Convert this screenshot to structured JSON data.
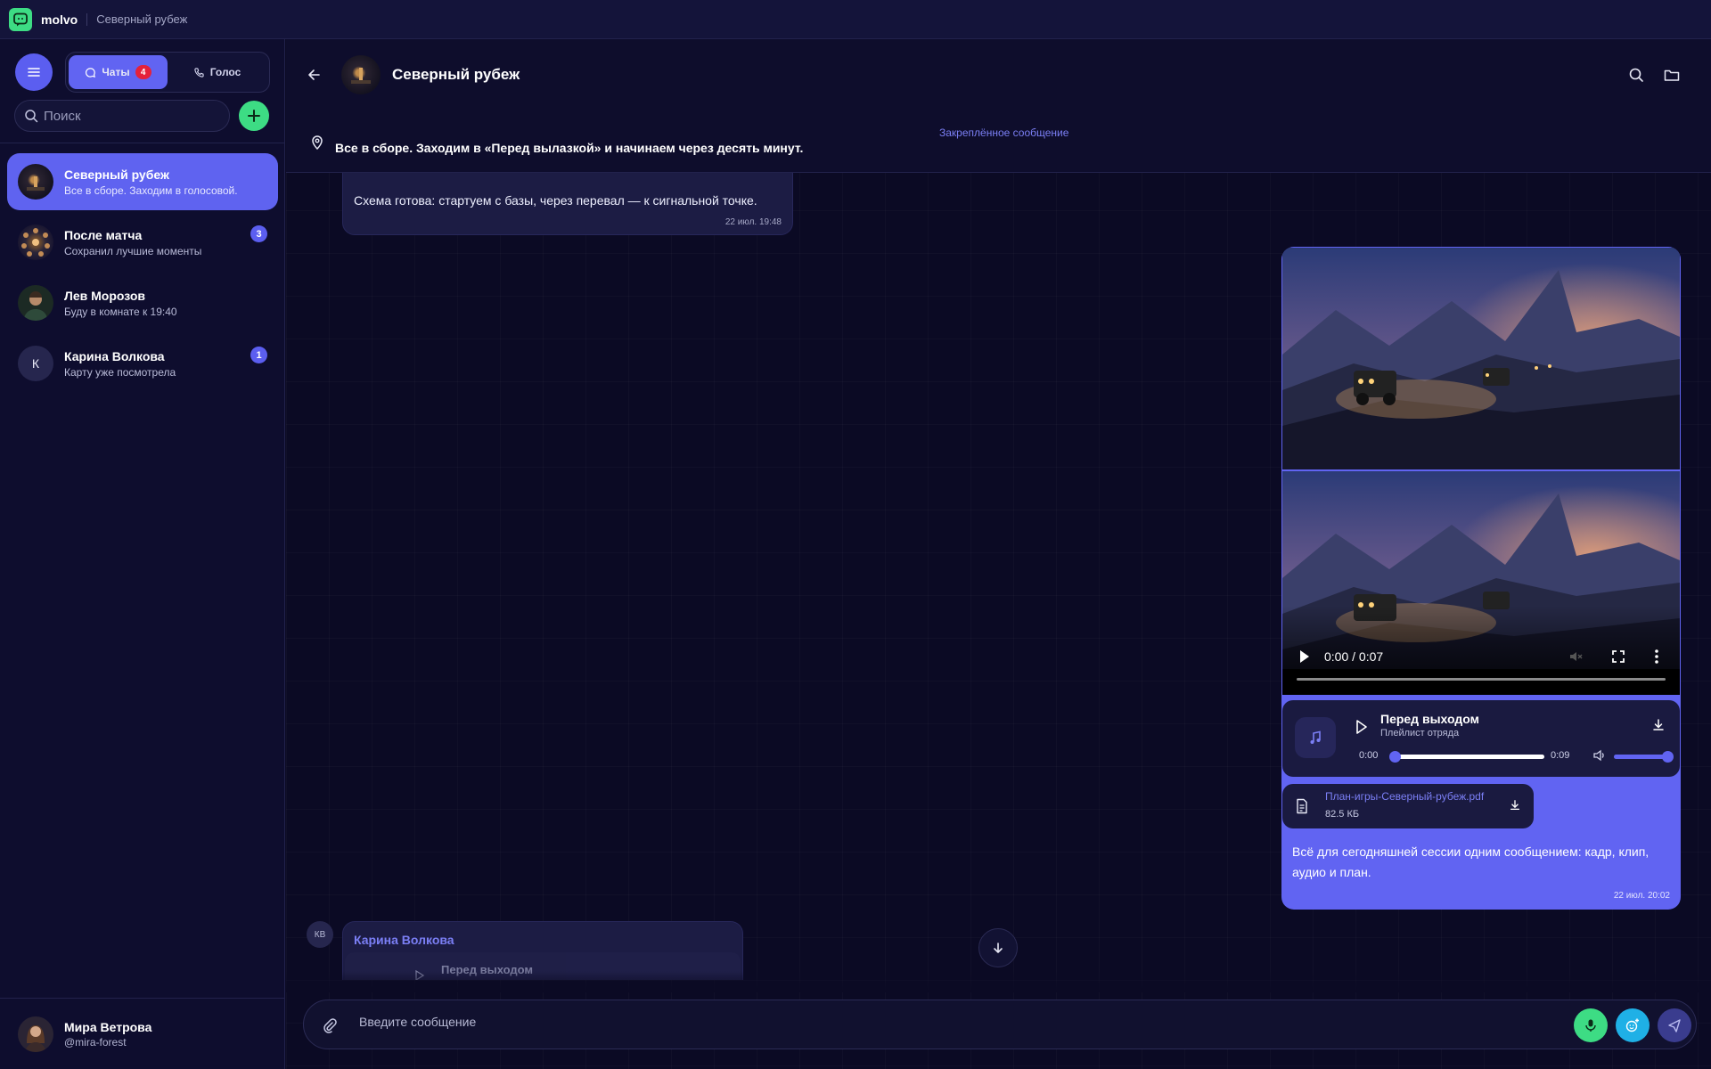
{
  "app": {
    "logo_text": "molvo",
    "window_title": "Северный рубеж"
  },
  "sidebar": {
    "tabs": [
      {
        "label": "Чаты",
        "badge": "4"
      },
      {
        "label": "Голос"
      }
    ],
    "search_placeholder": "Поиск",
    "chats": [
      {
        "name": "Северный рубеж",
        "preview": "Все в сборе. Заходим в голосовой.",
        "unread": ""
      },
      {
        "name": "После матча",
        "preview": "Сохранил лучшие моменты",
        "unread": "3"
      },
      {
        "name": "Лев Морозов",
        "preview": "Буду в комнате к 19:40",
        "unread": ""
      },
      {
        "name": "Карина Волкова",
        "preview": "Карту уже посмотрела",
        "unread": "1",
        "initial": "К"
      }
    ],
    "profile": {
      "name": "Мира Ветрова",
      "handle": "@mira-forest"
    }
  },
  "chat": {
    "title": "Северный рубеж",
    "pinned_label": "Закреплённое сообщение",
    "pinned_text": "Все в сборе. Заходим в «Перед вылазкой» и начинаем через десять минут.",
    "messages": {
      "incoming_1": {
        "text": "Схема готова: стартуем с базы, через перевал — к сигнальной точке.",
        "time": "22 июл. 19:48"
      },
      "outgoing": {
        "video_time": "0:00 / 0:07",
        "audio_title": "Перед выходом",
        "audio_subtitle": "Плейлист отряда",
        "audio_current": "0:00",
        "audio_duration": "0:09",
        "audio_progress": 0.0,
        "volume_level": 1.0,
        "file_name": "План-игры-Северный-рубеж.pdf",
        "file_size": "82.5 КБ",
        "text": "Всё для сегодняшней сессии одним сообщением: кадр, клип, аудио и план.",
        "time": "22 июл. 20:02"
      },
      "incoming_2": {
        "avatar_initials": "КВ",
        "sender": "Карина Волкова",
        "reply_title": "Перед выходом"
      }
    }
  },
  "composer": {
    "placeholder": "Введите сообщение"
  },
  "colors": {
    "accent": "#6164f2",
    "green": "#3ddc84",
    "cyan": "#1fb0e6",
    "background": "#0b0a24"
  }
}
